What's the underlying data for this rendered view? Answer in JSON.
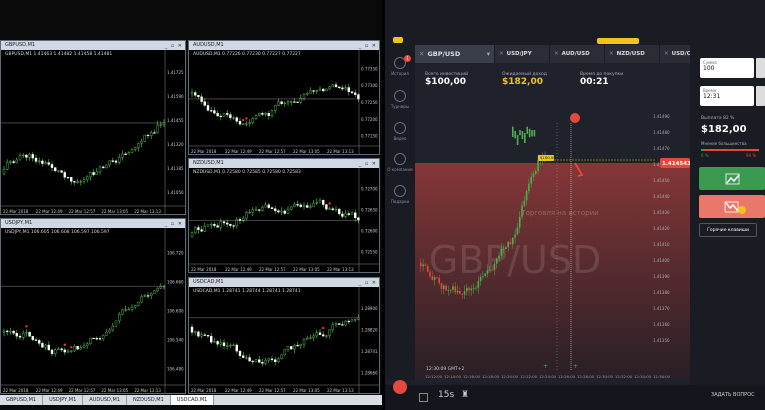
{
  "mt4": {
    "windows": [
      {
        "title": "GBPUSD,M1",
        "info": "GBPUSD,M1  1.41463 1.41482 1.41458 1.41481"
      },
      {
        "title": "AUDUSD,M1",
        "info": "AUDUSD,M1  0.77226 0.77230 0.77227 0.77227"
      },
      {
        "title": "USDJPY,M1",
        "info": "USDJPY,M1  106.605 106.608 106.597 106.597"
      },
      {
        "title": "NZDUSD,M1",
        "info": "NZDUSD,M1  0.72580 0.72585 0.72580 0.72583"
      },
      {
        "title": "USDCAD,M1",
        "info": "USDCAD,M1  1.28741 1.28744 1.28741 1.28741"
      }
    ],
    "tabs": [
      "GBPUSD,M1",
      "USDJPY,M1",
      "AUDUSD,M1",
      "NZDUSD,M1",
      "USDCAD,M1"
    ],
    "time_labels": [
      "22 Mar 2018",
      "22 Mar 12:49",
      "22 Mar 12:57",
      "22 Mar 13:05",
      "22 Mar 13:13"
    ],
    "ticks_gbp": [
      "1.41725",
      "1.41590",
      "1.41455",
      "1.41320",
      "1.41185",
      "1.41050"
    ],
    "ticks_aud": [
      "0.77350",
      "0.77300",
      "0.77250",
      "0.77200",
      "0.77150"
    ],
    "ticks_jpy": [
      "106.720",
      "106.660",
      "106.600",
      "106.540",
      "106.480"
    ],
    "ticks_nzd": [
      "0.72700",
      "0.72650",
      "0.72600",
      "0.72550"
    ],
    "ticks_cad": [
      "1.28900",
      "1.28820",
      "1.28741",
      "1.28660"
    ]
  },
  "iq": {
    "sidebar": [
      {
        "label": "История",
        "badge": "1"
      },
      {
        "label": "Турниры"
      },
      {
        "label": "Видео"
      },
      {
        "label": "О компании"
      },
      {
        "label": "Подарки"
      }
    ],
    "tabs": [
      "GBP/USD",
      "USD/JPY",
      "AUD/USD",
      "NZD/USD",
      "USD/CAD"
    ],
    "investment_label": "Всего инвестиций",
    "investment_value": "$100,00",
    "income_label": "Ожидаемый доход",
    "income_value": "$182,00",
    "time_label": "Время до покупки",
    "time_value": "00:21",
    "watermark": "GBP/USD",
    "watermark_sub": "Торговля на истории",
    "current_price": "1.414543",
    "entry_price": "$100.00",
    "price_ticks": [
      "1.41490",
      "1.41480",
      "1.41470",
      "1.41460",
      "1.41450",
      "1.41440",
      "1.41430",
      "1.41420",
      "1.41410",
      "1.41400",
      "1.41390",
      "1.41380",
      "1.41370",
      "1.41360",
      "1.41350"
    ],
    "time_ticks": [
      "12:12:00",
      "12:14:00",
      "12:16:00",
      "12:18:00",
      "12:20:00",
      "12:22:00",
      "12:24:00",
      "12:26:00",
      "12:28:00",
      "12:30:00",
      "12:32:00",
      "12:34:00",
      "12:36:00"
    ],
    "clock": "12:30:09 GMT+2",
    "amount_label": "Сумма",
    "amount_value": "100",
    "expiry_label": "Время",
    "expiry_value": "12:31",
    "payout_label": "Выплата 82 %",
    "payout_value": "$182,00",
    "majority_label": "Мнение большинства",
    "majority_up": "6 %",
    "majority_down": "94 %",
    "hotkeys": "Горячие клавиши",
    "period": "15s",
    "help": "ЗАДАТЬ ВОПРОС",
    "colors": {
      "call": "#3a9a50",
      "put": "#e9786a",
      "accent": "#f0c419"
    }
  }
}
